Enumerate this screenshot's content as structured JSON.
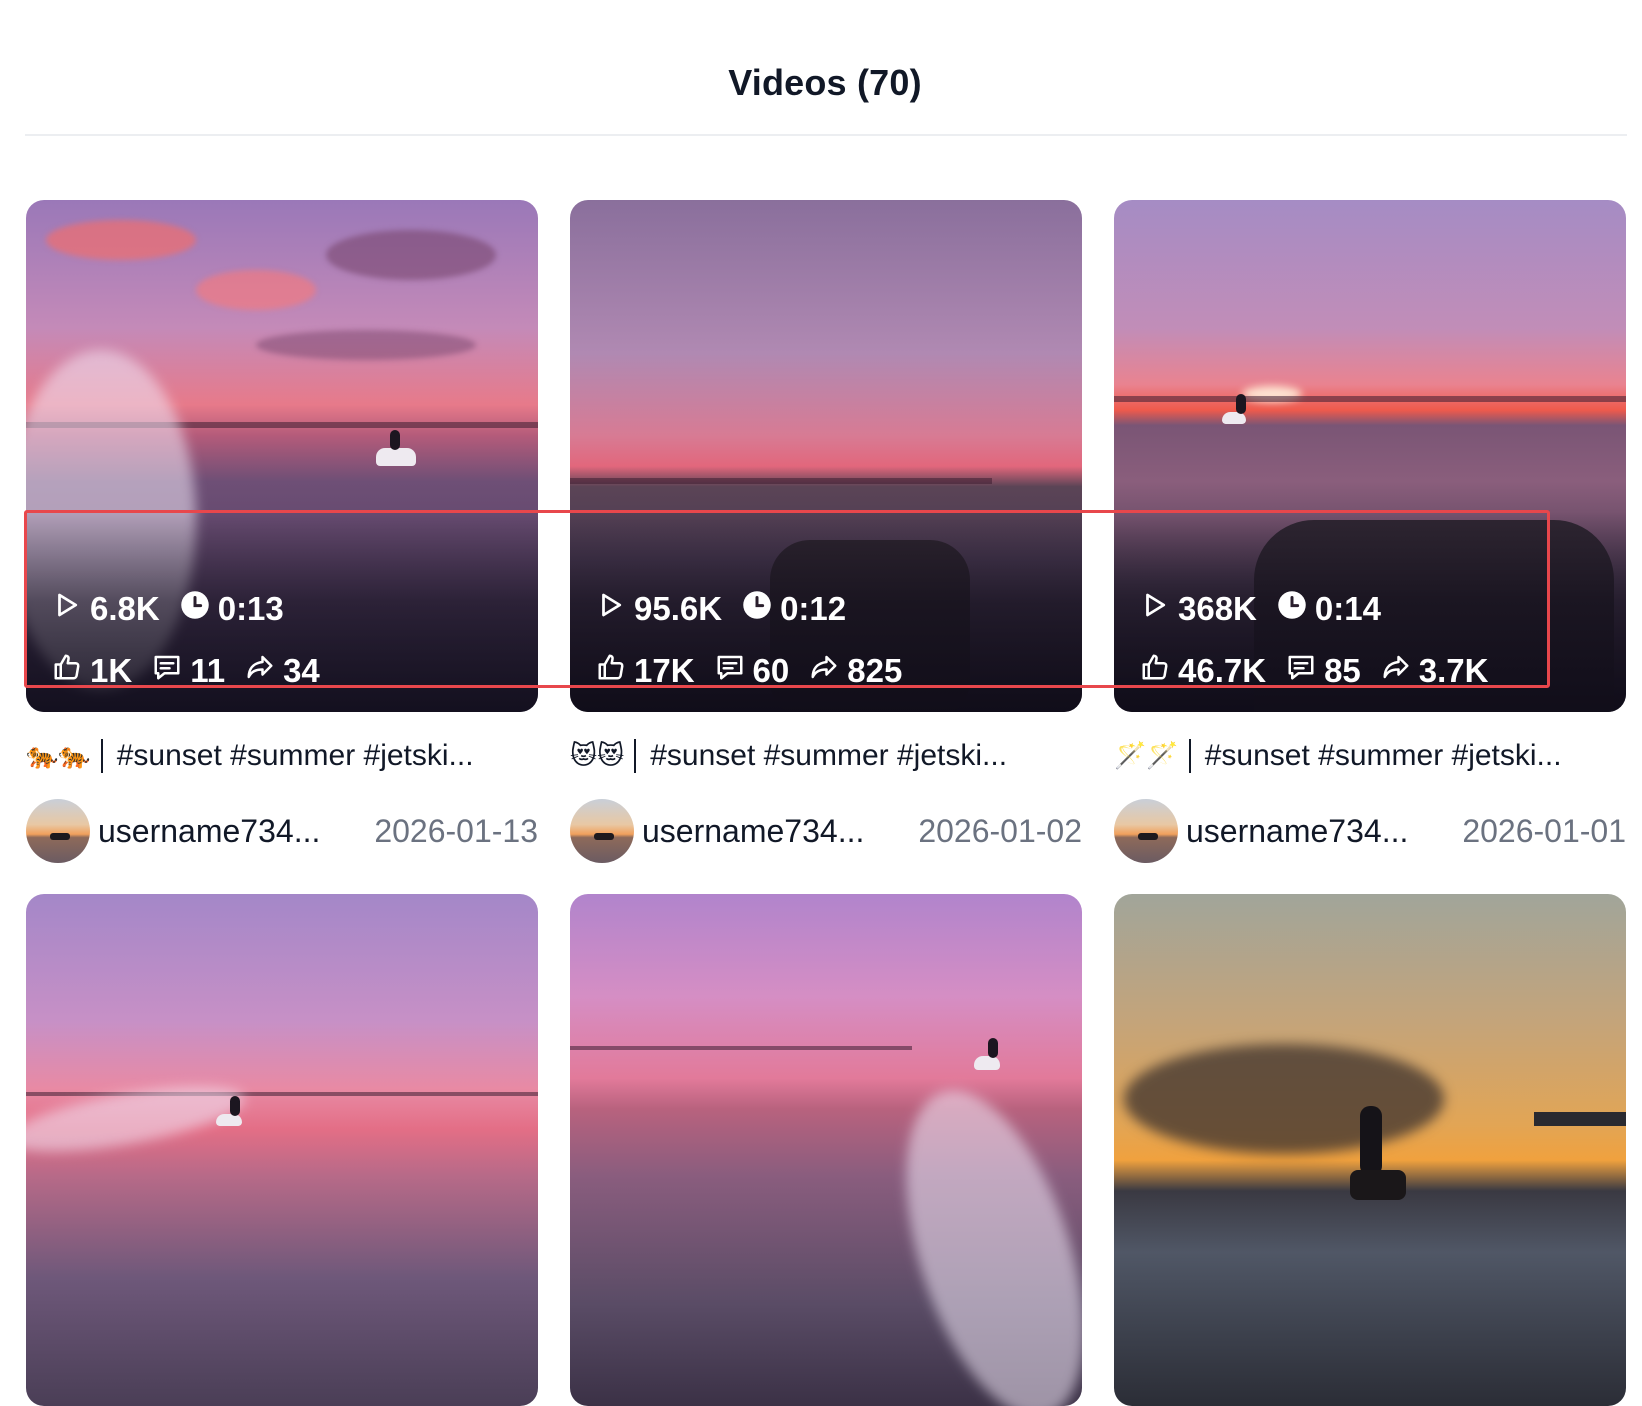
{
  "header": {
    "title": "Videos (70)"
  },
  "videos": [
    {
      "plays": "6.8K",
      "duration": "0:13",
      "likes": "1K",
      "comments": "11",
      "shares": "34",
      "caption_emoji": "🐅🐅",
      "caption": "#sunset #summer #jetski...",
      "author": "username734...",
      "date": "2026-01-13"
    },
    {
      "plays": "95.6K",
      "duration": "0:12",
      "likes": "17K",
      "comments": "60",
      "shares": "825",
      "caption_emoji": "😻😻",
      "caption": "#sunset #summer #jetski...",
      "author": "username734...",
      "date": "2026-01-02"
    },
    {
      "plays": "368K",
      "duration": "0:14",
      "likes": "46.7K",
      "comments": "85",
      "shares": "3.7K",
      "caption_emoji": "🪄🪄",
      "caption": "#sunset #summer #jetski...",
      "author": "username734...",
      "date": "2026-01-01"
    },
    {},
    {},
    {}
  ],
  "icons": {
    "plays": "play-icon",
    "duration": "clock-icon",
    "likes": "thumbs-up-icon",
    "comments": "comment-icon",
    "shares": "share-icon"
  },
  "colors": {
    "highlight": "#e8474c",
    "date": "#6b7280"
  }
}
